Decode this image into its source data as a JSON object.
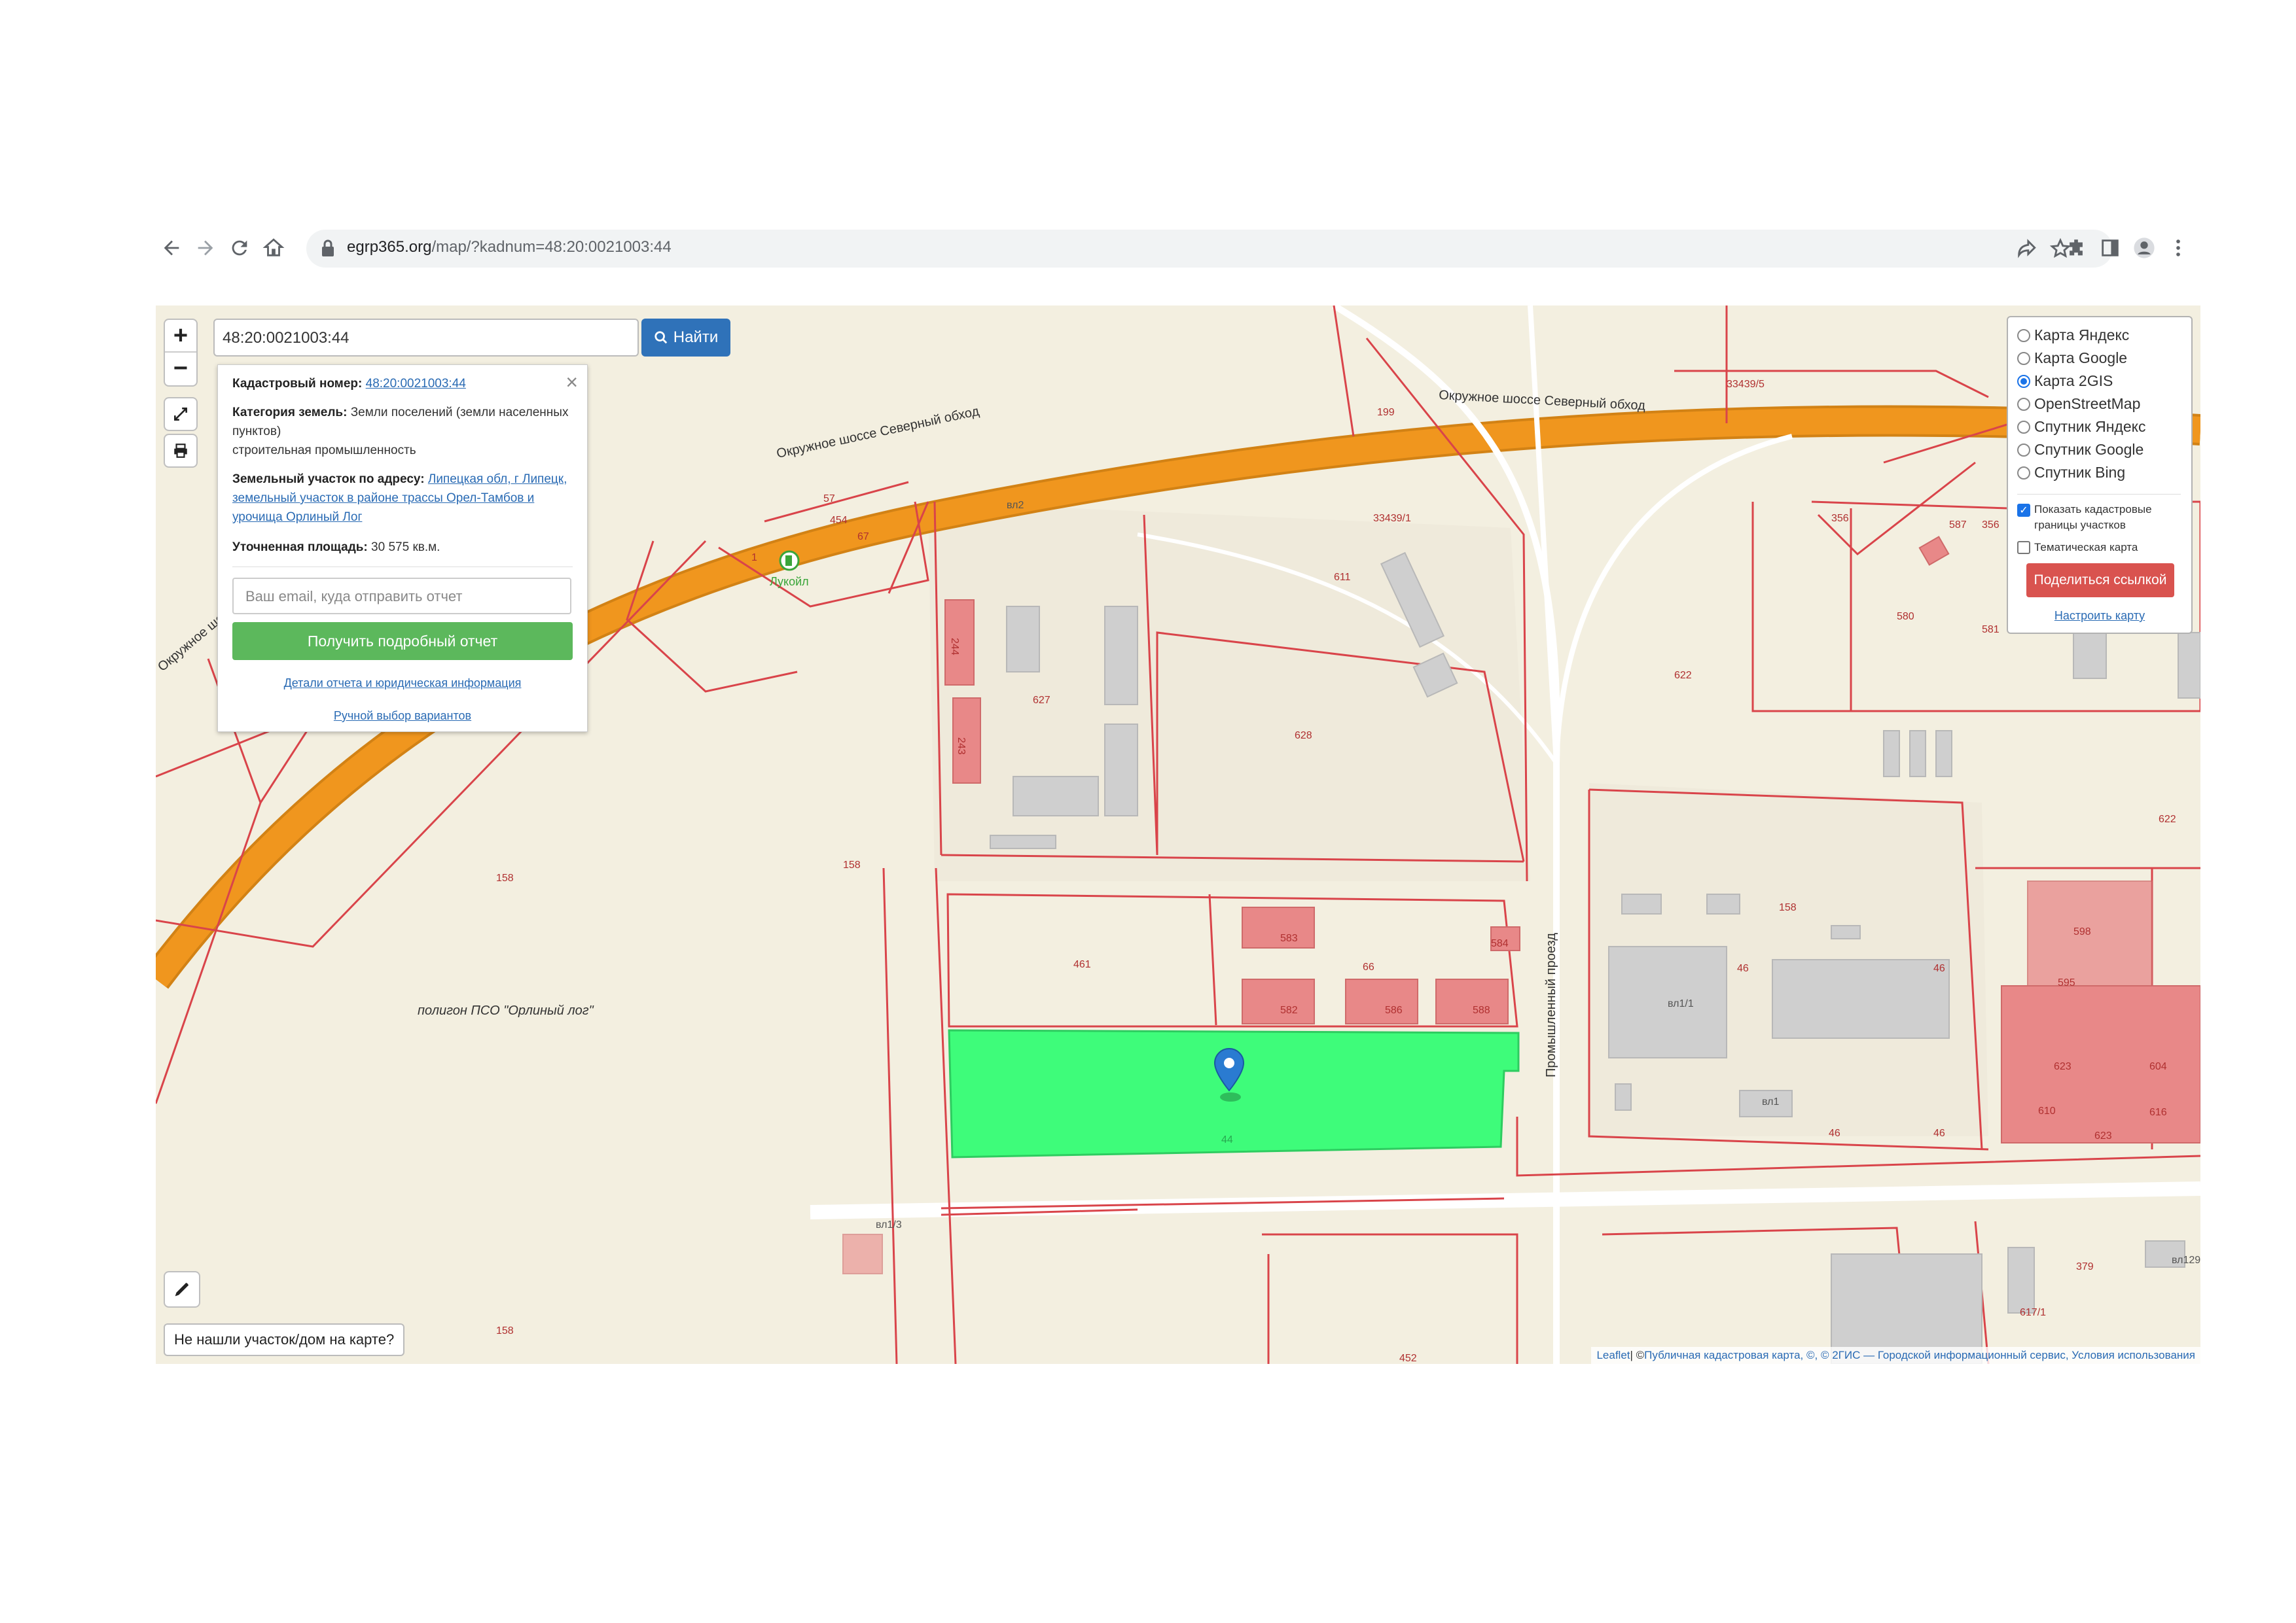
{
  "browser": {
    "url_host": "egrp365.org",
    "url_path": "/map/?kadnum=48:20:0021003:44"
  },
  "map": {
    "zoom_in": "+",
    "zoom_out": "−",
    "search_value": "48:20:0021003:44",
    "search_button": "Найти",
    "road_labels": [
      "Окружное шоссе Северный обход",
      "Окружное шоссе Северный обход",
      "Окружное шоссе",
      "Промышленный проезд"
    ],
    "parcel_labels": [
      "33439/1",
      "33439/5",
      "57",
      "454",
      "67",
      "1",
      "611",
      "199",
      "356",
      "356",
      "587",
      "580",
      "581",
      "622",
      "627",
      "628",
      "622",
      "158",
      "158",
      "158",
      "158",
      "461",
      "583",
      "584",
      "66",
      "582",
      "586",
      "588",
      "46",
      "46",
      "46",
      "46",
      "598",
      "595",
      "623",
      "604",
      "610",
      "616",
      "623",
      "617/1",
      "379",
      "452",
      "44",
      "вл2",
      "вл1/1",
      "вл1",
      "вл1/3",
      "вл129",
      "244",
      "243",
      "Лукойл"
    ],
    "area_label": "полигон ПСО \"Орлиный лог\"",
    "not_found": "Не нашли участок/дом на карте?",
    "attribution": {
      "leaflet": "Leaflet",
      "sep": " | © ",
      "source": "Публичная кадастровая карта, ©, © 2ГИС — Городской информационный сервис, Условия использования"
    },
    "colors": {
      "selected_parcel": "#3efc7a",
      "parcel_border": "#d9444a",
      "road": "#f0961e",
      "building": "#cfcfcf",
      "building_pink": "#e88888"
    }
  },
  "info": {
    "kadnum_label": "Кадастровый номер:",
    "kadnum_value": "48:20:0021003:44",
    "category_label": "Категория земель:",
    "category_value": "Земли поселений (земли населенных пунктов)",
    "category_use": "строительная промышленность",
    "address_label": "Земельный участок по адресу:",
    "address_value": "Липецкая обл, г Липецк, земельный участок в районе трассы Орел-Тамбов и урочища Орлиный Лог",
    "area_label": "Уточненная площадь:",
    "area_value": "30 575 кв.м.",
    "email_placeholder": "Ваш email, куда отправить отчет",
    "report_button": "Получить подробный отчет",
    "details_link": "Детали отчета и юридическая информация",
    "manual_link": "Ручной выбор вариантов"
  },
  "layers": {
    "options": [
      {
        "label": "Карта Яндекс",
        "selected": false
      },
      {
        "label": "Карта Google",
        "selected": false
      },
      {
        "label": "Карта 2GIS",
        "selected": true
      },
      {
        "label": "OpenStreetMap",
        "selected": false
      },
      {
        "label": "Спутник Яндекс",
        "selected": false
      },
      {
        "label": "Спутник Google",
        "selected": false
      },
      {
        "label": "Спутник Bing",
        "selected": false
      }
    ],
    "show_cadastral_line1": "Показать кадастровые",
    "show_cadastral_line2": "границы участков",
    "show_cadastral_checked": true,
    "thematic": "Тематическая карта",
    "thematic_checked": false,
    "share_button": "Поделиться ссылкой",
    "configure_link": "Настроить карту"
  }
}
